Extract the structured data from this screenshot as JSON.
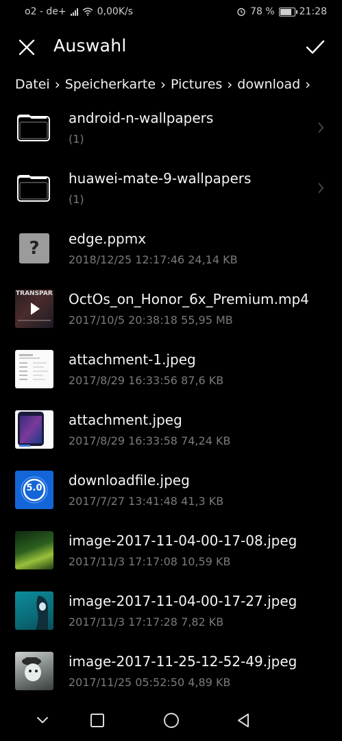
{
  "status_bar": {
    "carrier": "o2 - de+",
    "network_speed": "0,00K/s",
    "battery_percent": "78 %",
    "battery_level": 0.78,
    "time": "21:28"
  },
  "header": {
    "title": "Auswahl",
    "close_icon": "close-icon",
    "confirm_icon": "check-icon"
  },
  "breadcrumb": [
    "Datei",
    "Speicherkarte",
    "Pictures",
    "download"
  ],
  "files": [
    {
      "name": "android-n-wallpapers",
      "meta": "(1)",
      "type": "folder"
    },
    {
      "name": "huawei-mate-9-wallpapers",
      "meta": "(1)",
      "type": "folder"
    },
    {
      "name": "edge.ppmx",
      "meta": "2018/12/25 12:17:46 24,14 KB",
      "type": "unknown"
    },
    {
      "name": "OctOs_on_Honor_6x_Premium.mp4",
      "meta": "2017/10/5 20:38:18 55,95 MB",
      "type": "video"
    },
    {
      "name": "attachment-1.jpeg",
      "meta": "2017/8/29 16:33:56 87,6 KB",
      "type": "image"
    },
    {
      "name": "attachment.jpeg",
      "meta": "2017/8/29 16:33:58 74,24 KB",
      "type": "image"
    },
    {
      "name": "downloadfile.jpeg",
      "meta": "2017/7/27 13:41:48 41,3 KB",
      "type": "image"
    },
    {
      "name": "image-2017-11-04-00-17-08.jpeg",
      "meta": "2017/11/3 17:17:08 10,59 KB",
      "type": "image"
    },
    {
      "name": "image-2017-11-04-00-17-27.jpeg",
      "meta": "2017/11/3 17:17:28 7,82 KB",
      "type": "image"
    },
    {
      "name": "image-2017-11-25-12-52-49.jpeg",
      "meta": "2017/11/25 05:52:50 4,89 KB",
      "type": "image"
    }
  ],
  "thumb_texts": {
    "video_overlay": "TRANSPAR",
    "badge": "5.0"
  },
  "colors": {
    "background": "#000000",
    "text_primary": "#f5f5f5",
    "text_secondary": "#7a7a7a"
  }
}
